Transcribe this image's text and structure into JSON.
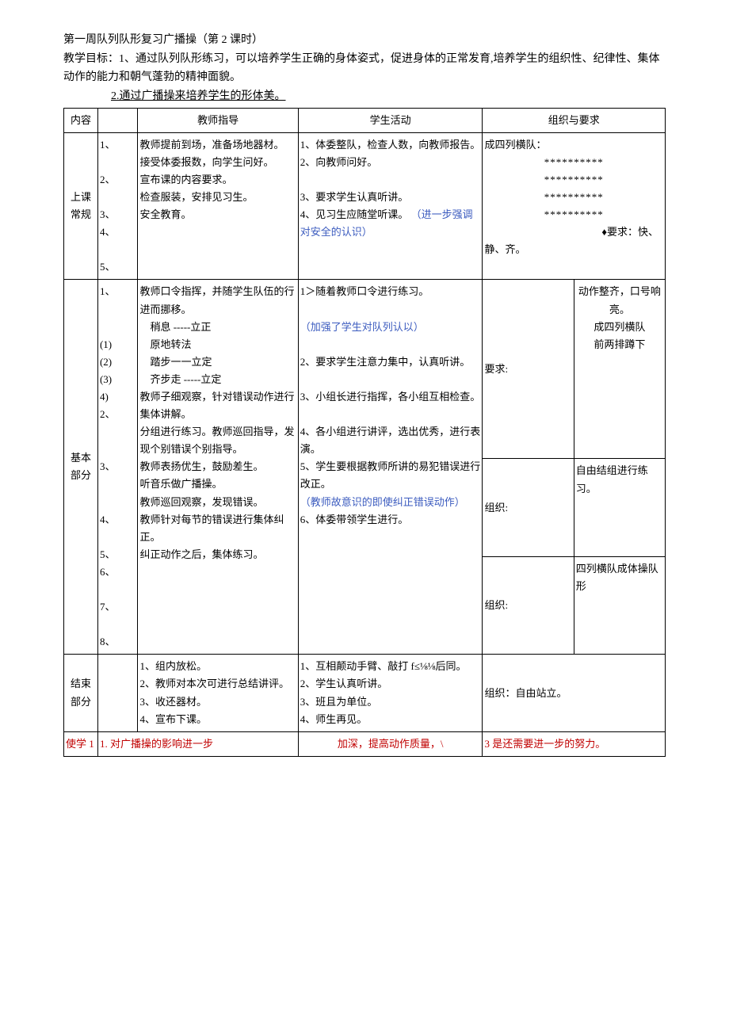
{
  "title_line": "第一周队列队形复习广播操（第 2 课时）",
  "goal_line1": "教学目标：1、通过队列队形练习，可以培养学生正确的身体姿式，促进身体的正常发育,培养学生的组织性、纪律性、集体动作的能力和朝气蓬勃的精神面貌。",
  "goal_line2": "2.通过广播操来培养学生的形体美。",
  "headers": {
    "content": "内容",
    "teacher": "教师指导",
    "student": "学生活动",
    "org": "组织与要求"
  },
  "row1": {
    "section": "上课常规",
    "nums": "1、\n\n2、\n\n3、\n4、\n\n5、",
    "teacher": "教师提前到场，准备场地器材。\n接受体委报数，向学生问好。\n宣布课的内容要求。\n检查服装，安排见习生。\n安全教育。",
    "student_p1": "1、体委整队，检查人数，向教师报告。\n2、向教师问好。\n\n3、要求学生认真听讲。\n4、见习生应随堂听课。",
    "student_blue": "（进一步强调对安全的认识）",
    "org_text1": "成四列横队：",
    "org_stars": "**********\n**********\n**********\n**********",
    "org_req": "♦要求：快、静、齐。"
  },
  "row2": {
    "section": "基本部分",
    "nums": "1、\n\n\n(1)\n(2)\n(3)\n4)\n2、\n\n\n3、\n\n\n4、\n\n5、\n6、\n\n7、\n\n8、",
    "teacher": "教师口令指挥，并随学生队伍的行进而挪移。\n　稍息 -----立正\n　原地转法\n　踏步一一立定\n　齐步走 -----立定\n教师子细观察，针对错误动作进行集体讲解。\n分组进行练习。教师巡回指导，发现个别错误个别指导。\n教师表扬优生，鼓励差生。\n听音乐做广播操。\n教师巡回观察，发现错误。\n教师针对每节的错误进行集体纠正。\n纠正动作之后，集体练习。",
    "student_l1": "1＞随着教师口令进行练习。",
    "student_blue1": "（加强了学生对队列认以）",
    "student_l2": "2、要求学生注意力集中，认真听讲。",
    "student_l3": "3、小组长进行指挥，各小组互相检查。",
    "student_l4": "4、各小组进行讲评，选出优秀，进行表演。",
    "student_l5": "5、学生要根据教师所讲的易犯错误进行改正。",
    "student_blue2": "（教师故意识的即使纠正错误动作）",
    "student_l6": "6、体委带领学生进行。",
    "org_label1": "要求:",
    "org_req1": "动作整齐，口号响亮。\n成四列横队\n前两排蹲下",
    "org_label2": "组织:",
    "org_req2": "自由结组进行练习。",
    "org_label3": "组织:",
    "org_req3": "四列横队成体操队形"
  },
  "row3": {
    "section": "结束部分",
    "teacher": "1、组内放松。\n2、教师对本次可进行总结讲评。\n3、收还器材。\n4、宣布下课。",
    "student": "1、互相颠动手臂、敲打 f≤⅛⅛后同。\n2、学生认真听讲。\n3、班且为单位。\n4、师生再见。",
    "org": "组织：自由站立。"
  },
  "row4": {
    "left": "使学 1",
    "mid_left": "1. 对广播操的影响进一步",
    "mid": "加深，提高动作质量，\\",
    "right": "3 是还需要进一步的努力。"
  }
}
